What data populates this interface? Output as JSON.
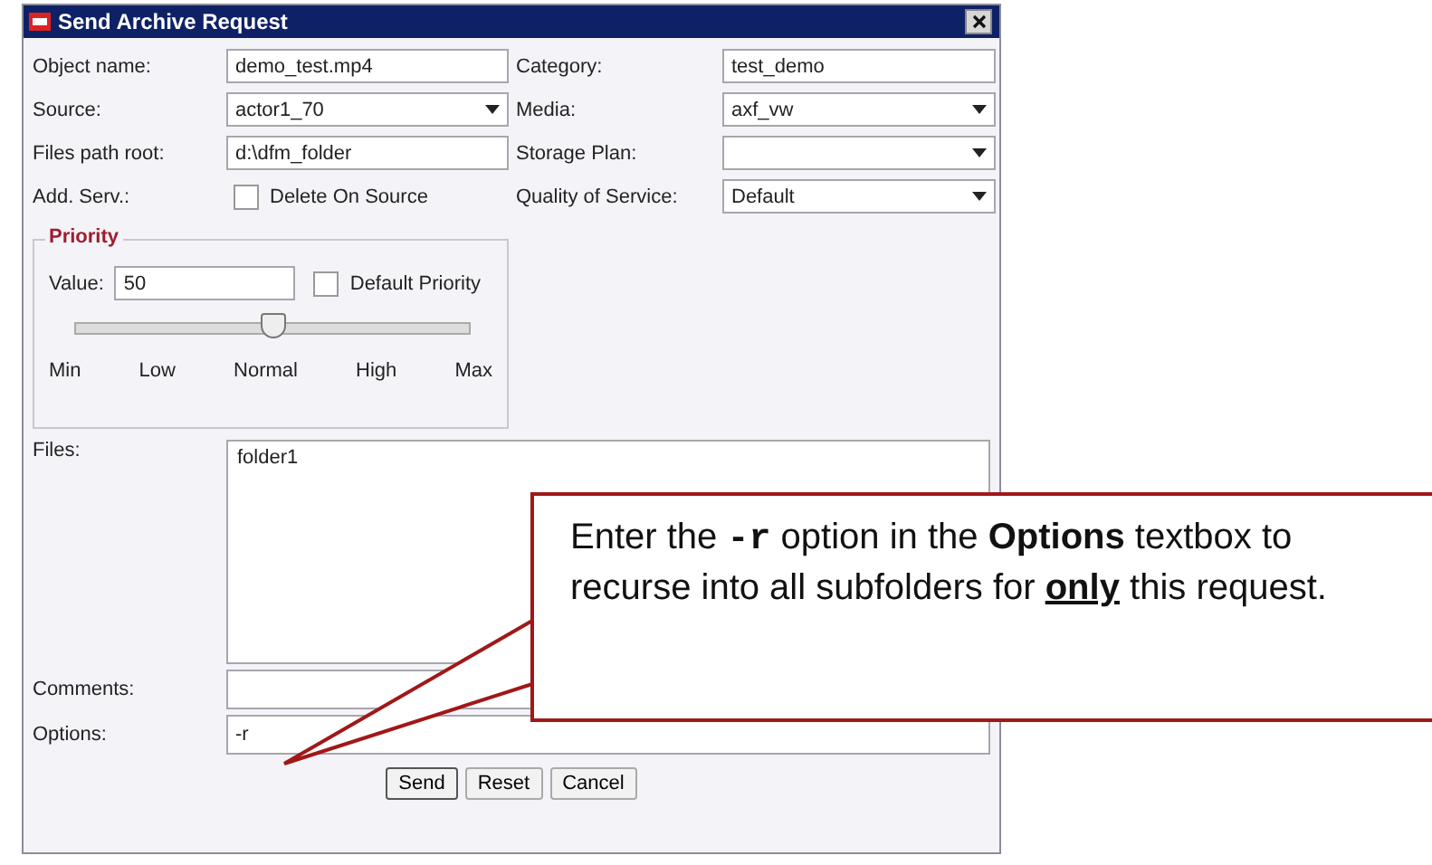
{
  "window": {
    "title": "Send Archive Request"
  },
  "rows": [
    {
      "left": {
        "label": "Object name:",
        "kind": "text",
        "value": "demo_test.mp4"
      },
      "right": {
        "label": "Category:",
        "kind": "text",
        "value": "test_demo"
      }
    },
    {
      "left": {
        "label": "Source:",
        "kind": "select",
        "value": "actor1_70"
      },
      "right": {
        "label": "Media:",
        "kind": "select",
        "value": "axf_vw"
      }
    },
    {
      "left": {
        "label": "Files path root:",
        "kind": "text",
        "value": "d:\\dfm_folder"
      },
      "right": {
        "label": "Storage Plan:",
        "kind": "select"
      }
    },
    {
      "left": {
        "label": "Add. Serv.:",
        "kind": "checkbox",
        "text": "Delete On Source",
        "checked": false
      },
      "right": {
        "label": "Quality of Service:",
        "kind": "select",
        "value": "Default"
      }
    }
  ],
  "priority": {
    "title": "Priority",
    "value_label": "Value:",
    "value": "50",
    "default_label": "Default Priority",
    "default_checked": false,
    "level": 0.5,
    "ticks": [
      "Min",
      "Low",
      "Normal",
      "High",
      "Max"
    ]
  },
  "files": {
    "label": "Files:",
    "items": [
      "folder1"
    ]
  },
  "comments": {
    "label": "Comments:"
  },
  "options": {
    "label": "Options:",
    "value": "-r"
  },
  "buttons": [
    "Send",
    "Reset",
    "Cancel"
  ],
  "callout": {
    "segments": [
      {
        "kind": "plain",
        "text": "Enter the "
      },
      {
        "kind": "code",
        "text": "-r"
      },
      {
        "kind": "plain",
        "text": " option in the "
      },
      {
        "kind": "bold",
        "text": "Options"
      },
      {
        "kind": "plain",
        "text": " textbox to recurse into all subfolders for "
      },
      {
        "kind": "underline",
        "text": "only"
      },
      {
        "kind": "plain",
        "text": " this request."
      }
    ]
  }
}
